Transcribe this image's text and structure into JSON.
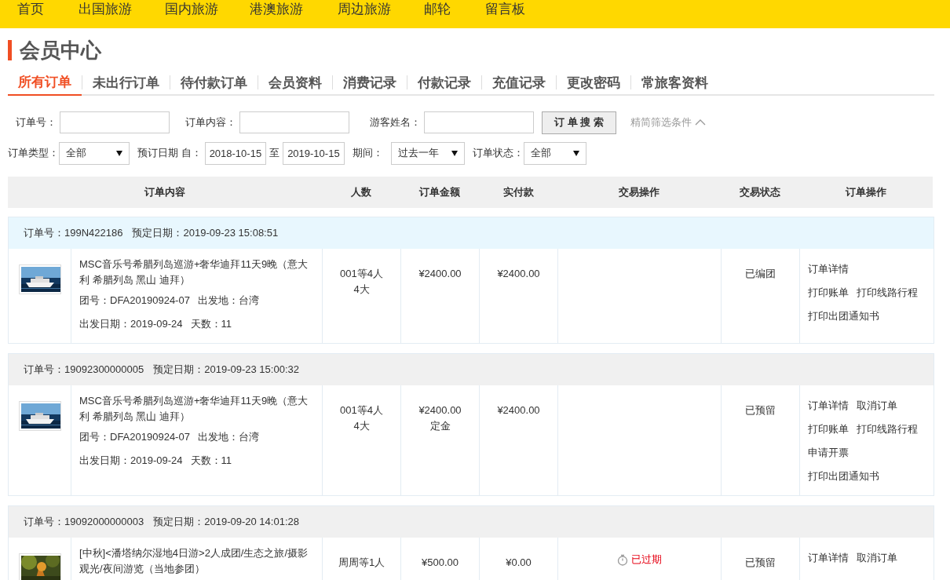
{
  "nav": [
    {
      "label": "首页"
    },
    {
      "label": "出国旅游"
    },
    {
      "label": "国内旅游"
    },
    {
      "label": "港澳旅游"
    },
    {
      "label": "周边旅游"
    },
    {
      "label": "邮轮"
    },
    {
      "label": "留言板"
    }
  ],
  "page_title": "会员中心",
  "tabs": [
    {
      "label": "所有订单",
      "selected": true
    },
    {
      "label": "未出行订单",
      "selected": false
    },
    {
      "label": "待付款订单",
      "selected": false
    },
    {
      "label": "会员资料",
      "selected": false
    },
    {
      "label": "消费记录",
      "selected": false
    },
    {
      "label": "付款记录",
      "selected": false
    },
    {
      "label": "充值记录",
      "selected": false
    },
    {
      "label": "更改密码",
      "selected": false
    },
    {
      "label": "常旅客资料",
      "selected": false
    }
  ],
  "search": {
    "fields": [
      {
        "label": "订单号："
      },
      {
        "label": "订单内容："
      },
      {
        "label": "游客姓名："
      }
    ],
    "button": "订 单 搜 索",
    "toggle": "精简筛选条件"
  },
  "filters": {
    "type_label": "订单类型：",
    "type_value": "全部",
    "date_label": "预订日期 自：",
    "date_from": "2018-10-15",
    "date_to_label": "至",
    "date_to": "2019-10-15",
    "period_label": "期间：",
    "period_value": "过去一年",
    "status_label": "订单状态：",
    "status_value": "全部"
  },
  "table": {
    "columns": [
      "订单内容",
      "人数",
      "订单金额",
      "实付款",
      "交易操作",
      "交易状态",
      "订单操作"
    ],
    "orders": [
      {
        "highlighted": true,
        "order_no": "订单号：199N422186",
        "booked": "预定日期：2019-09-23 15:08:51",
        "title": "MSC音乐号希腊列岛巡游+奢华迪拜11天9晚（意大利 希腊列岛 黑山 迪拜）",
        "group": "团号：DFA20190924-07",
        "origin": "出发地：台湾",
        "depart": "出发日期：2019-09-24",
        "days": "天数：11",
        "people": [
          "001等4人",
          "4大"
        ],
        "amount": [
          "¥2400.00"
        ],
        "paid": "¥2400.00",
        "status": "已编团",
        "actions": [
          [
            "订单详情"
          ],
          [
            "打印账单",
            "打印线路行程"
          ],
          [
            "打印出团通知书"
          ]
        ]
      },
      {
        "highlighted": false,
        "order_no": "订单号：19092300000005",
        "booked": "预定日期：2019-09-23 15:00:32",
        "title": "MSC音乐号希腊列岛巡游+奢华迪拜11天9晚（意大利 希腊列岛 黑山 迪拜）",
        "group": "团号：DFA20190924-07",
        "origin": "出发地：台湾",
        "depart": "出发日期：2019-09-24",
        "days": "天数：11",
        "people": [
          "001等4人",
          "4大"
        ],
        "amount": [
          "¥2400.00",
          "定金"
        ],
        "paid": "¥2400.00",
        "status": "已预留",
        "actions": [
          [
            "订单详情",
            "取消订单"
          ],
          [
            "打印账单",
            "打印线路行程"
          ],
          [
            "申请开票"
          ],
          [
            "打印出团通知书"
          ]
        ]
      },
      {
        "highlighted": false,
        "order_no": "订单号：19092000000003",
        "booked": "预定日期：2019-09-20 14:01:28",
        "title": "[中秋]<潘塔纳尔湿地4日游>2人成团/生态之旅/摄影观光/夜间游览（当地参团）",
        "people": [
          "周周等1人"
        ],
        "amount": [
          "¥500.00"
        ],
        "paid": "¥0.00",
        "trade": {
          "kind": "expired",
          "label": "已过期"
        },
        "status": "已预留",
        "actions": [
          [
            "订单详情",
            "取消订单"
          ]
        ]
      }
    ]
  }
}
